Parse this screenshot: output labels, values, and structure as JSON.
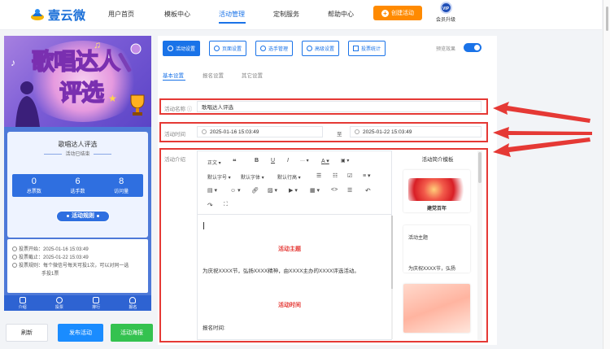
{
  "brand": {
    "name": "壹云微"
  },
  "nav": {
    "items": [
      {
        "label": "用户首页"
      },
      {
        "label": "模板中心"
      },
      {
        "label": "活动管理"
      },
      {
        "label": "定制服务"
      },
      {
        "label": "帮助中心"
      }
    ],
    "active_index": 2,
    "create_button": "创建活动",
    "vip_badge": "VIP",
    "vip_label": "会员升级"
  },
  "preview": {
    "banner_line1": "歌唱达人",
    "banner_line2": "评选",
    "activity_title": "歌唱达人评选",
    "status": "活动已结束",
    "stats": [
      {
        "value": "0",
        "label": "总票数"
      },
      {
        "value": "6",
        "label": "选手数"
      },
      {
        "value": "8",
        "label": "访问量"
      }
    ],
    "rules_button": "活动规则",
    "info": [
      "投票开始：2025-01-16 15:03:49",
      "投票截止：2025-01-22 15:03:49",
      "投票规则：每个微信号每天可投1次，可以对同一选",
      "手投1票"
    ],
    "tabs": [
      "介绍",
      "投票",
      "排行",
      "报名"
    ]
  },
  "actions": {
    "refresh": "刷新",
    "publish": "发布活动",
    "poster": "活动海报"
  },
  "toolbar": {
    "buttons": [
      "活动设置",
      "页面设置",
      "选手管理",
      "高级设置",
      "投票统计"
    ],
    "preview_label": "预览效果"
  },
  "subtabs": [
    "基本设置",
    "报名设置",
    "其它设置"
  ],
  "form": {
    "name_label": "活动名称",
    "name_value": "歌唱达人评选",
    "time_label": "活动时间",
    "time_start": "2025-01-16 15:03:49",
    "time_sep": "至",
    "time_end": "2025-01-22 15:03:49",
    "intro_label": "活动介绍"
  },
  "editor": {
    "tools_row1": [
      "正文",
      "❝",
      "B",
      "U",
      "I",
      "···",
      "A",
      "▣"
    ],
    "font_size": "默认字号",
    "font_family": "默认字体",
    "line_height": "默认行高",
    "heading1": "活动主题",
    "paragraph1": "为庆祝XXXX节，弘扬XXXX精神，由XXXX主办的XXXX评选活动。",
    "heading2": "活动时间",
    "paragraph2": "报名时间:"
  },
  "templates": {
    "title": "活动简介模板",
    "card1_caption": "建党百年",
    "card2_title": "活动主题",
    "card2_text": "为庆祝XXXX节，弘扬"
  },
  "colors": {
    "accent": "#1a73e8",
    "highlight": "#e53935",
    "create": "#ff8a00",
    "poster": "#34c24f"
  }
}
